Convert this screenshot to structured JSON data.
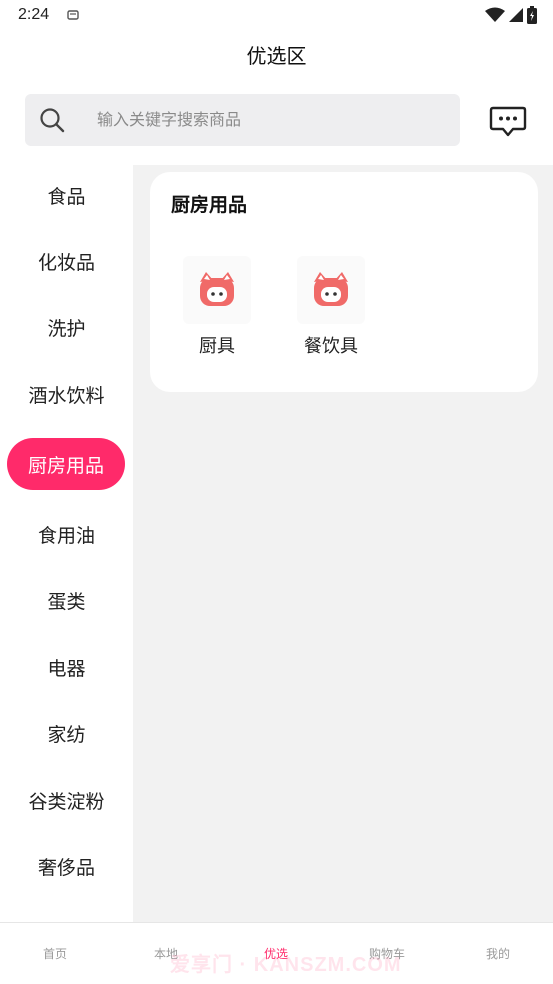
{
  "status_bar": {
    "time": "2:24"
  },
  "header": {
    "title": "优选区"
  },
  "search": {
    "placeholder": "输入关键字搜索商品"
  },
  "sidebar": {
    "items": [
      {
        "label": "食品"
      },
      {
        "label": "化妆品"
      },
      {
        "label": "洗护"
      },
      {
        "label": "酒水饮料"
      },
      {
        "label": "厨房用品",
        "active": true
      },
      {
        "label": "食用油"
      },
      {
        "label": "蛋类"
      },
      {
        "label": "电器"
      },
      {
        "label": "家纺"
      },
      {
        "label": "谷类淀粉"
      },
      {
        "label": "奢侈品"
      }
    ]
  },
  "panel": {
    "title": "厨房用品",
    "items": [
      {
        "label": "厨具",
        "icon": "pig-placeholder-icon"
      },
      {
        "label": "餐饮具",
        "icon": "pig-placeholder-icon"
      }
    ]
  },
  "bottom_nav": {
    "items": [
      {
        "label": "首页"
      },
      {
        "label": "本地"
      },
      {
        "label": "优选",
        "active": true
      },
      {
        "label": "购物车"
      },
      {
        "label": "我的"
      }
    ]
  },
  "watermark": "爱享门 · KANSZM.COM",
  "colors": {
    "accent": "#ff2a6a",
    "content_bg": "#f2f2f2",
    "search_bg": "#eeeef0"
  }
}
